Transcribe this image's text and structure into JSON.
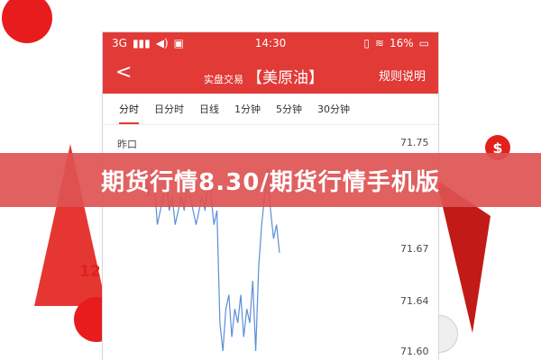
{
  "status": {
    "signal": "3G",
    "time": "14:30",
    "battery": "16%"
  },
  "nav": {
    "back_label": "<",
    "title_small": "实盘交易",
    "title_main": "【美原油】",
    "rules_label": "规则说明"
  },
  "tabs": [
    {
      "label": "分时"
    },
    {
      "label": "日分时"
    },
    {
      "label": "日线"
    },
    {
      "label": "1分钟"
    },
    {
      "label": "5分钟"
    },
    {
      "label": "30分钟"
    }
  ],
  "chart": {
    "partial_label": "昨口"
  },
  "chart_data": {
    "type": "line",
    "x": [
      0,
      1,
      2,
      3,
      4,
      5,
      6,
      7,
      8,
      9,
      10,
      11,
      12,
      13,
      14,
      15,
      16,
      17,
      18,
      19,
      20,
      21,
      22,
      23,
      24,
      25,
      26,
      27,
      28,
      29,
      30,
      31,
      32,
      33,
      34,
      35,
      36,
      37,
      38,
      39,
      40,
      41,
      42,
      43,
      44,
      45,
      46
    ],
    "y": [
      71.72,
      71.73,
      71.71,
      71.73,
      71.72,
      71.69,
      71.7,
      71.71,
      71.72,
      71.7,
      71.71,
      71.69,
      71.7,
      71.71,
      71.7,
      71.72,
      71.71,
      71.7,
      71.69,
      71.7,
      71.71,
      71.7,
      71.72,
      71.71,
      71.69,
      71.7,
      71.62,
      71.6,
      71.63,
      71.64,
      71.61,
      71.63,
      71.62,
      71.64,
      71.61,
      71.63,
      71.62,
      71.65,
      71.6,
      71.66,
      71.69,
      71.71,
      71.73,
      71.7,
      71.68,
      71.69,
      71.67
    ],
    "yticks": [
      "71.75",
      "71.67",
      "71.64",
      "71.60"
    ],
    "ylim": [
      71.6,
      71.75
    ]
  },
  "banner": {
    "text": "期货行情8.30/期货行情手机版"
  },
  "decor": {
    "number": "12",
    "accent": "#e13a37"
  }
}
